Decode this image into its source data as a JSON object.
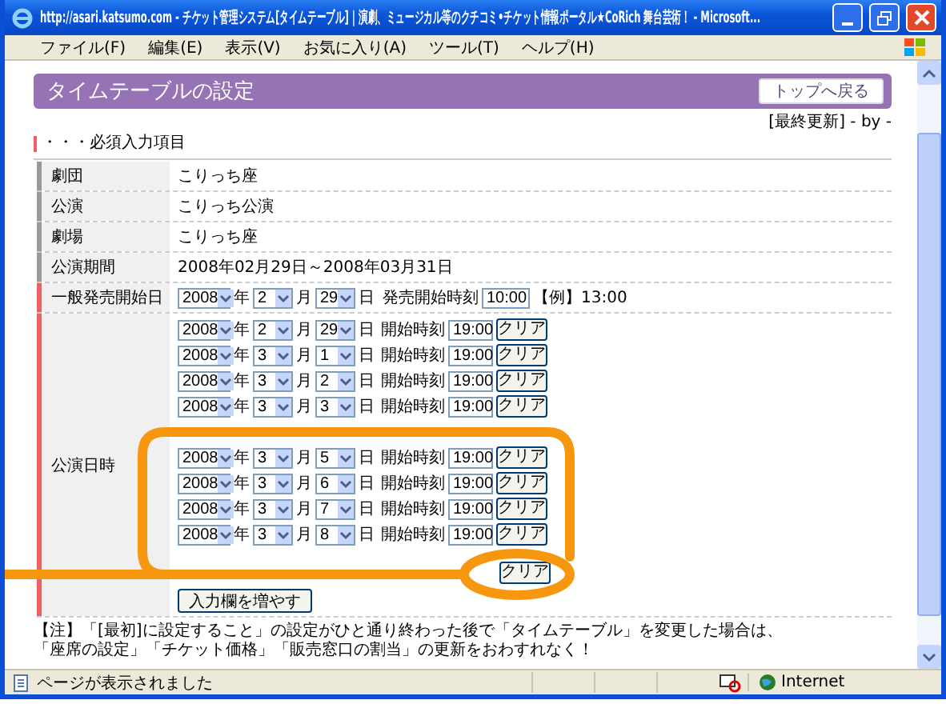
{
  "window": {
    "title": "http://asari.katsumo.com - チケット管理システム[タイムテーブル] | 演劇、ミュージカル等のクチコミ•チケット情報ポータル★CoRich 舞台芸術！ - Microsoft...",
    "menu": [
      "ファイル(F)",
      "編集(E)",
      "表示(V)",
      "お気に入り(A)",
      "ツール(T)",
      "ヘルプ(H)"
    ]
  },
  "page": {
    "title": "タイムテーブルの設定",
    "back_button": "トップへ戻る",
    "updated": "[最終更新] - by -",
    "required_note": "・・・必須入力項目",
    "fields": [
      {
        "kind": "text",
        "label": "劇団",
        "value": "こりっち座",
        "required": false
      },
      {
        "kind": "text",
        "label": "公演",
        "value": "こりっち公演",
        "required": false
      },
      {
        "kind": "text",
        "label": "劇場",
        "value": "こりっち座",
        "required": false
      },
      {
        "kind": "text",
        "label": "公演期間",
        "value": "2008年02月29日～2008年03月31日",
        "required": false
      },
      {
        "kind": "date",
        "label": "一般発売開始日",
        "required": true,
        "year": "2008",
        "year_unit": "年",
        "month": "2",
        "month_unit": "月",
        "day": "29",
        "day_unit": "日",
        "time_label": "発売開始時刻",
        "time": "10:00",
        "example": "【例】13:00"
      }
    ],
    "schedule": {
      "label": "公演日時",
      "required": true,
      "add_button": "入力欄を増やす",
      "rows": [
        {
          "kind": "full",
          "year": "2008",
          "year_unit": "年",
          "month": "2",
          "month_unit": "月",
          "day": "29",
          "day_unit": "日",
          "time_label": "開始時刻",
          "time": "19:00",
          "clear": "クリア"
        },
        {
          "kind": "full",
          "year": "2008",
          "year_unit": "年",
          "month": "3",
          "month_unit": "月",
          "day": "1",
          "day_unit": "日",
          "time_label": "開始時刻",
          "time": "19:00",
          "clear": "クリア"
        },
        {
          "kind": "full",
          "year": "2008",
          "year_unit": "年",
          "month": "3",
          "month_unit": "月",
          "day": "2",
          "day_unit": "日",
          "time_label": "開始時刻",
          "time": "19:00",
          "clear": "クリア"
        },
        {
          "kind": "full",
          "year": "2008",
          "year_unit": "年",
          "month": "3",
          "month_unit": "月",
          "day": "3",
          "day_unit": "日",
          "time_label": "開始時刻",
          "time": "19:00",
          "clear": "クリア"
        },
        {
          "kind": "covered"
        },
        {
          "kind": "full",
          "year": "2008",
          "year_unit": "年",
          "month": "3",
          "month_unit": "月",
          "day": "5",
          "day_unit": "日",
          "time_label": "開始時刻",
          "time": "19:00",
          "clear": "クリア"
        },
        {
          "kind": "full",
          "year": "2008",
          "year_unit": "年",
          "month": "3",
          "month_unit": "月",
          "day": "6",
          "day_unit": "日",
          "time_label": "開始時刻",
          "time": "19:00",
          "clear": "クリア"
        },
        {
          "kind": "full",
          "year": "2008",
          "year_unit": "年",
          "month": "3",
          "month_unit": "月",
          "day": "7",
          "day_unit": "日",
          "time_label": "開始時刻",
          "time": "19:00",
          "clear": "クリア"
        },
        {
          "kind": "full",
          "year": "2008",
          "year_unit": "年",
          "month": "3",
          "month_unit": "月",
          "day": "8",
          "day_unit": "日",
          "time_label": "開始時刻",
          "time": "19:00",
          "clear": "クリア"
        },
        {
          "kind": "partial",
          "clear": "クリア"
        }
      ]
    },
    "note_lines": [
      "【注】「[最初]に設定すること」の設定がひと通り終わった後で「タイムテーブル」を変更した場合は、",
      "「座席の設定」「チケット価格」「販売窓口の割当」の更新をおわすれなく！"
    ]
  },
  "status_bar": {
    "text": "ページが表示されました",
    "zone": "Internet"
  }
}
